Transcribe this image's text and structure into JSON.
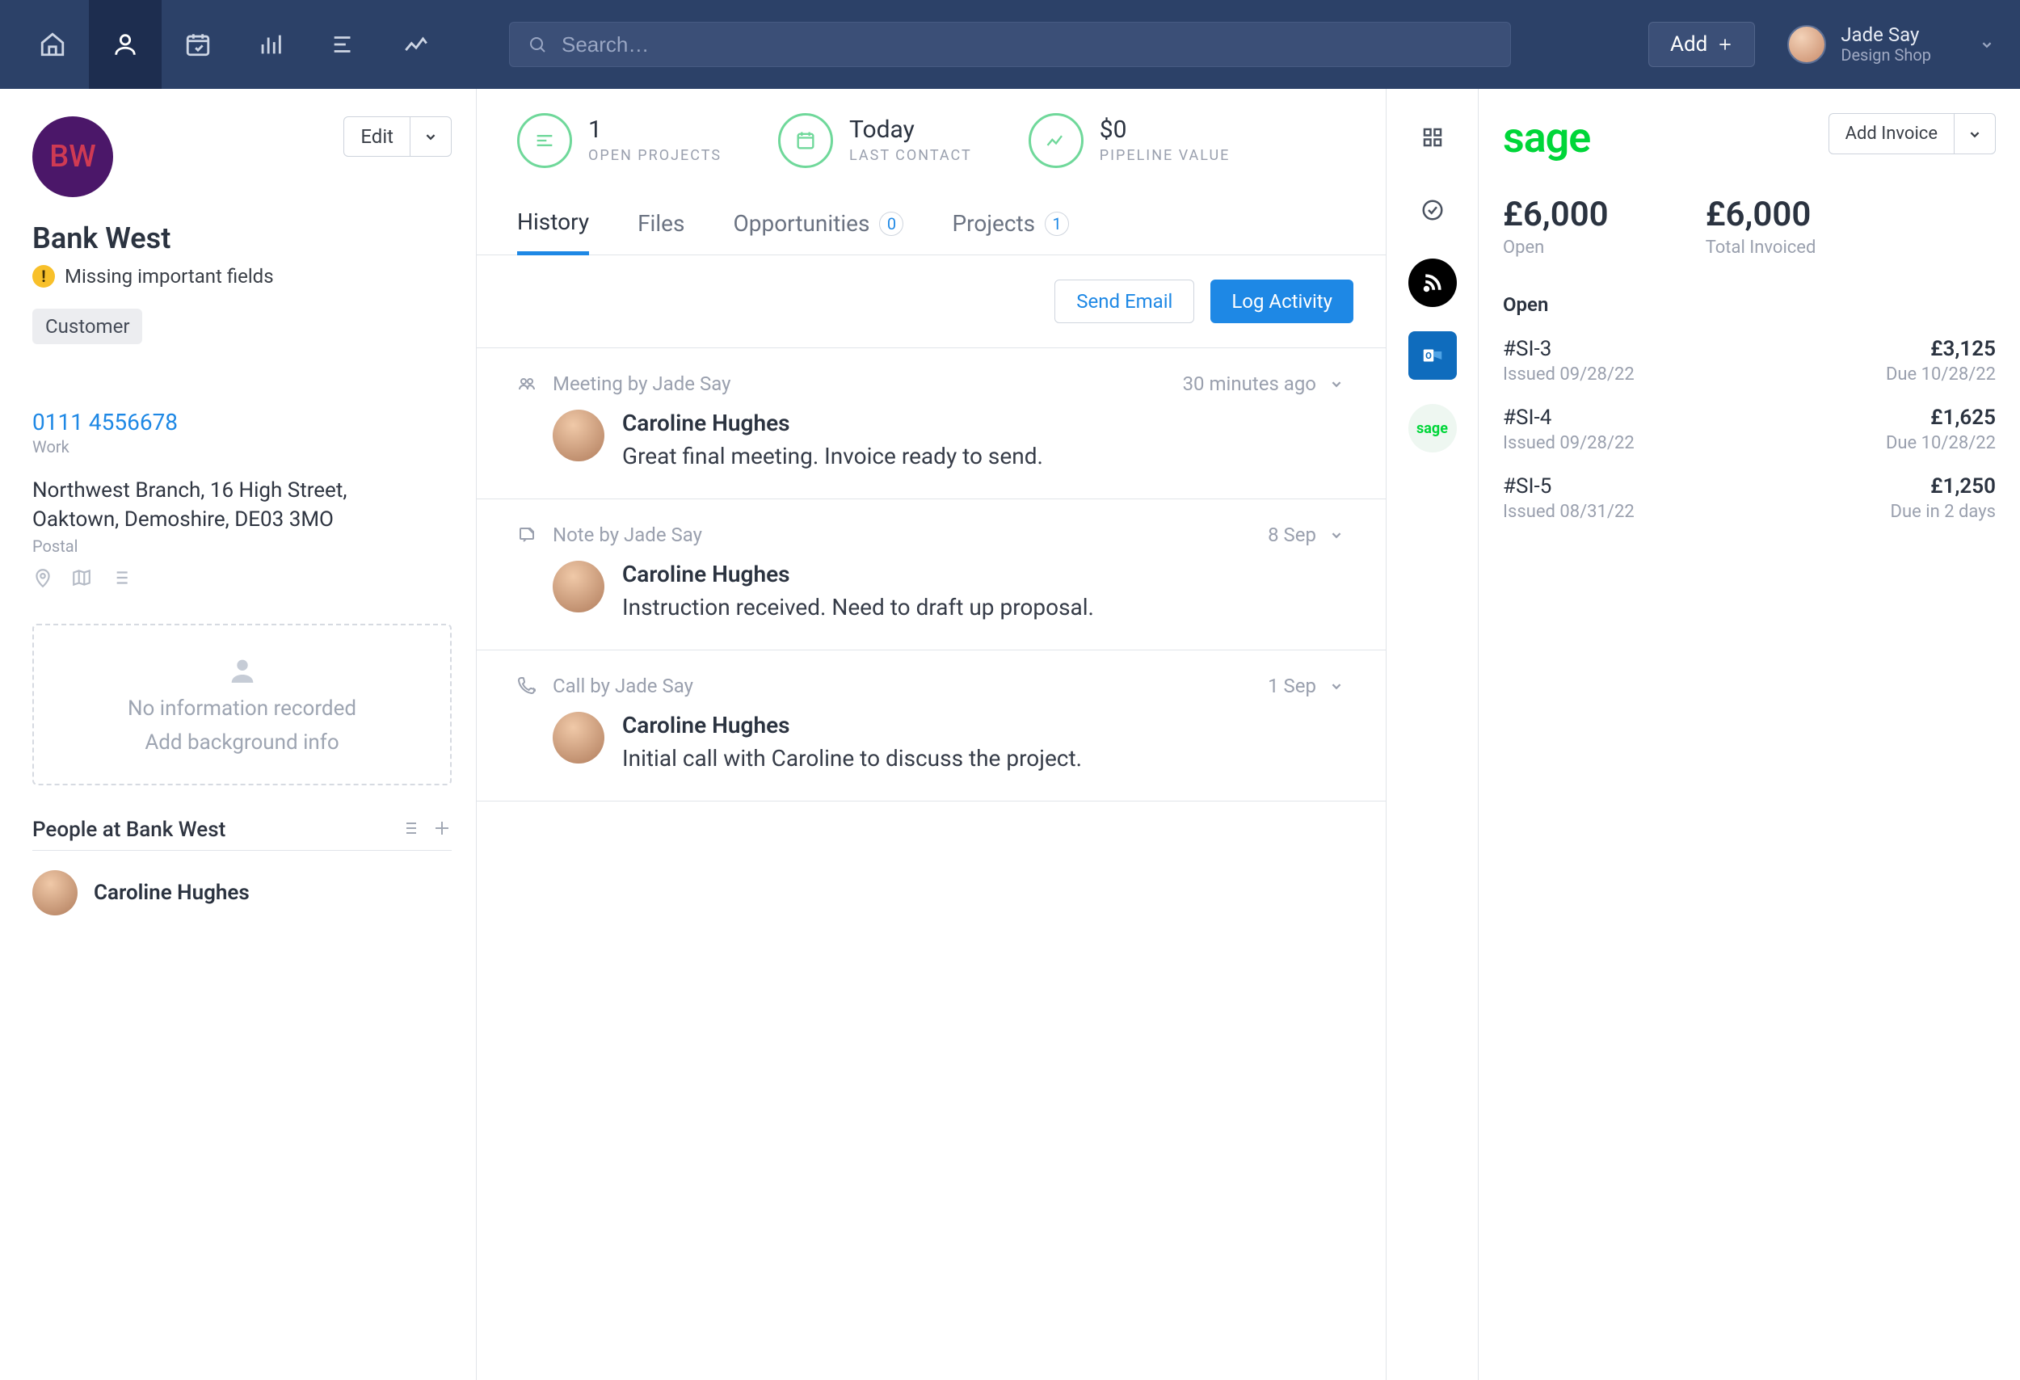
{
  "header": {
    "search_placeholder": "Search…",
    "add_label": "Add",
    "user_name": "Jade Say",
    "user_sub": "Design Shop"
  },
  "left": {
    "avatar_initials": "BW",
    "edit_label": "Edit",
    "org_name": "Bank West",
    "warning": "Missing important fields",
    "tag": "Customer",
    "phone": "0111 4556678",
    "phone_label": "Work",
    "address_line1": "Northwest Branch, 16 High Street,",
    "address_line2": "Oaktown, Demoshire, DE03 3MO",
    "address_label": "Postal",
    "bg_empty1": "No information recorded",
    "bg_empty2": "Add background info",
    "people_heading": "People at Bank West",
    "person_name": "Caroline Hughes"
  },
  "center": {
    "metrics": {
      "open_projects_value": "1",
      "open_projects_label": "OPEN PROJECTS",
      "last_contact_value": "Today",
      "last_contact_label": "LAST CONTACT",
      "pipeline_value": "$0",
      "pipeline_label": "PIPELINE VALUE"
    },
    "tabs": {
      "history": "History",
      "files": "Files",
      "opportunities": "Opportunities",
      "opportunities_count": "0",
      "projects": "Projects",
      "projects_count": "1"
    },
    "actions": {
      "send_email": "Send Email",
      "log_activity": "Log Activity"
    },
    "feed": [
      {
        "type_label": "Meeting by Jade Say",
        "time": "30 minutes ago",
        "name": "Caroline Hughes",
        "msg": "Great final meeting. Invoice ready to send."
      },
      {
        "type_label": "Note by Jade Say",
        "time": "8 Sep",
        "name": "Caroline Hughes",
        "msg": "Instruction received. Need to draft up proposal."
      },
      {
        "type_label": "Call by Jade Say",
        "time": "1 Sep",
        "name": "Caroline Hughes",
        "msg": "Initial call with Caroline to discuss the project."
      }
    ]
  },
  "right": {
    "logo_text": "sage",
    "add_invoice": "Add Invoice",
    "totals": {
      "open_amount": "£6,000",
      "open_label": "Open",
      "invoiced_amount": "£6,000",
      "invoiced_label": "Total Invoiced"
    },
    "open_heading": "Open",
    "invoices": [
      {
        "id": "#SI-3",
        "issued": "Issued 09/28/22",
        "amount": "£3,125",
        "due": "Due 10/28/22"
      },
      {
        "id": "#SI-4",
        "issued": "Issued 09/28/22",
        "amount": "£1,625",
        "due": "Due 10/28/22"
      },
      {
        "id": "#SI-5",
        "issued": "Issued 08/31/22",
        "amount": "£1,250",
        "due": "Due in 2 days"
      }
    ]
  }
}
